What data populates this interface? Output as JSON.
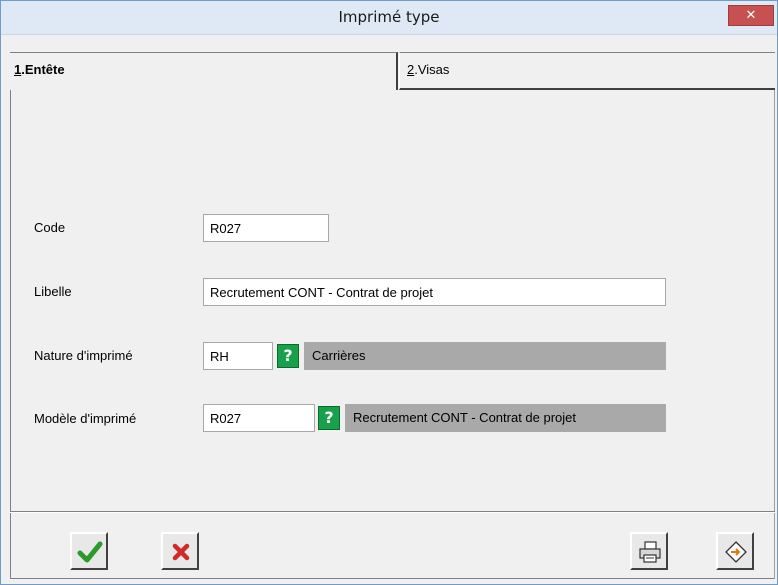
{
  "window": {
    "title": "Imprimé type",
    "close_glyph": "✕"
  },
  "tabs": [
    {
      "num": "1",
      "label": ".Entête"
    },
    {
      "num": "2",
      "label": ".Visas"
    }
  ],
  "form": {
    "code": {
      "label": "Code",
      "value": "R027"
    },
    "libelle": {
      "label": "Libelle",
      "value": "Recrutement CONT - Contrat de projet"
    },
    "nature": {
      "label": "Nature d'imprimé",
      "value": "RH",
      "help": "?",
      "description": "Carrières"
    },
    "modele": {
      "label": "Modèle d'imprimé",
      "value": "R027",
      "help": "?",
      "description": "Recrutement CONT - Contrat de projet"
    }
  },
  "toolbar": {
    "ok_icon": "check-icon",
    "cancel_icon": "x-icon",
    "print_icon": "printer-icon",
    "export_icon": "diamond-arrow-icon"
  },
  "colors": {
    "titlebar": "#dfe9f5",
    "close": "#c75050",
    "help": "#19a04a",
    "readonly": "#a9a9a9"
  }
}
